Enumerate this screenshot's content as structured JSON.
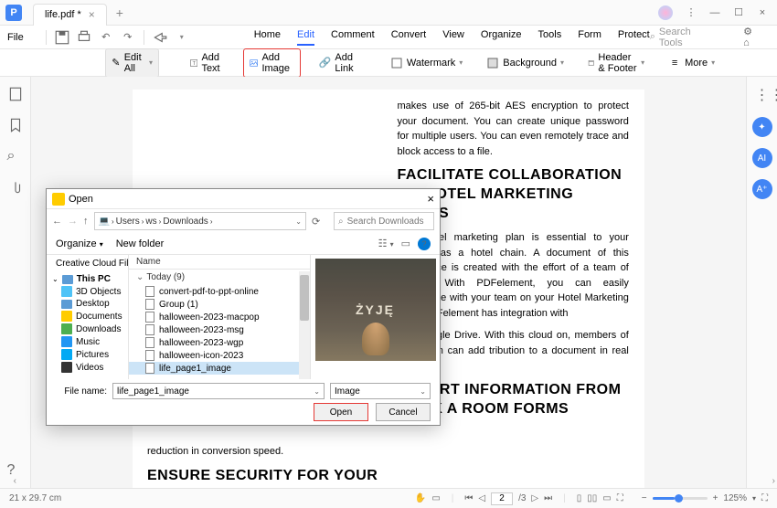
{
  "titlebar": {
    "tab_name": "life.pdf *"
  },
  "menu": {
    "file": "File",
    "tabs": [
      "Home",
      "Edit",
      "Comment",
      "Convert",
      "View",
      "Organize",
      "Tools",
      "Form",
      "Protect"
    ],
    "search_placeholder": "Search Tools"
  },
  "toolbar": {
    "edit_all": "Edit All",
    "add_text": "Add Text",
    "add_image": "Add Image",
    "add_link": "Add Link",
    "watermark": "Watermark",
    "background": "Background",
    "header_footer": "Header & Footer",
    "more": "More"
  },
  "doc": {
    "right": {
      "p1": "makes use of 265-bit AES encryption to protect your document. You can create unique password for multiple users. You can even remotely trace and block access to a file.",
      "h1": "FACILITATE COLLABORATION ON HOTEL MARKETING PLANS",
      "p2": "Your hotel marketing plan is essential to your success as a hotel chain. A document of this importance is created with the effort of a team of experts. With PDFelement, you can easily collaborate with your team on your Hotel Marketing Plan. PDFelement has integration with",
      "p2b": "and Google Drive. With this cloud on, members of your team can add tribution to a document in real time.",
      "h2": "EXPORT INFORMATION FROM BOOK A ROOM FORMS"
    },
    "left": {
      "p1": "reduction in conversion speed.",
      "h1": "ENSURE SECURITY FOR YOUR HOTEL BUSINESS PLAN"
    }
  },
  "dialog": {
    "title": "Open",
    "path": [
      "Users",
      "ws",
      "Downloads"
    ],
    "search_placeholder": "Search Downloads",
    "organize": "Organize",
    "new_folder": "New folder",
    "tree": [
      "Creative Cloud Fil",
      "This PC",
      "3D Objects",
      "Desktop",
      "Documents",
      "Downloads",
      "Music",
      "Pictures",
      "Videos"
    ],
    "col_name": "Name",
    "group": "Today (9)",
    "files": [
      "convert-pdf-to-ppt-online",
      "Group (1)",
      "halloween-2023-macpop",
      "halloween-2023-msg",
      "halloween-2023-wgp",
      "halloween-icon-2023",
      "life_page1_image"
    ],
    "selected_index": 6,
    "filename_label": "File name:",
    "filename_value": "life_page1_image",
    "filter": "Image",
    "open": "Open",
    "cancel": "Cancel",
    "preview_text": "ŻYJĘ"
  },
  "status": {
    "dims": "21 x 29.7 cm",
    "page": "2",
    "total": "/3",
    "zoom": "125%"
  }
}
